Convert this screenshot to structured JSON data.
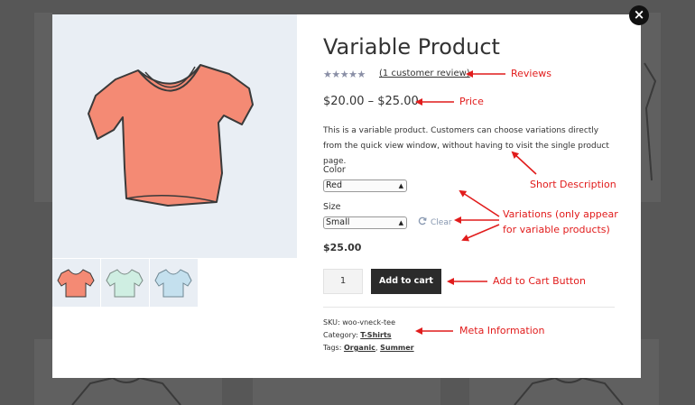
{
  "product": {
    "title": "Variable Product",
    "stars": "★★★★★",
    "review_link": "(1 customer review)",
    "price_range": "$20.00 – $25.00",
    "description": "This is a variable product. Customers can choose variations directly from the quick view window, without having to visit the single product page.",
    "color_label": "Color",
    "color_value": "Red",
    "size_label": "Size",
    "size_value": "Small",
    "clear_label": "Clear",
    "selected_price": "$25.00",
    "quantity": "1",
    "add_to_cart": "Add to cart",
    "sku_label": "SKU:",
    "sku_value": "woo-vneck-tee",
    "category_label": "Category:",
    "category_value": "T-Shirts",
    "tags_label": "Tags:",
    "tag_1": "Organic",
    "tag_sep": ",",
    "tag_2": "Summer"
  },
  "close_symbol": "×",
  "annotations": {
    "reviews": "Reviews",
    "price": "Price",
    "short_description": "Short Description",
    "variations_line1": "Variations (only appear",
    "variations_line2": "for variable products)",
    "add_to_cart_button": "Add to Cart Button",
    "meta_information": "Meta Information"
  },
  "colors": {
    "annotation": "#e11c1c",
    "shirt_main": "#f48a74",
    "shirt_mint": "#cfeee2",
    "shirt_blue": "#c4e0ee",
    "button": "#2b2b2b",
    "stars": "#8a8fa6"
  },
  "icons": {
    "close": "close-icon",
    "refresh": "refresh-icon",
    "select_arrow": "chevron-updown-icon"
  }
}
